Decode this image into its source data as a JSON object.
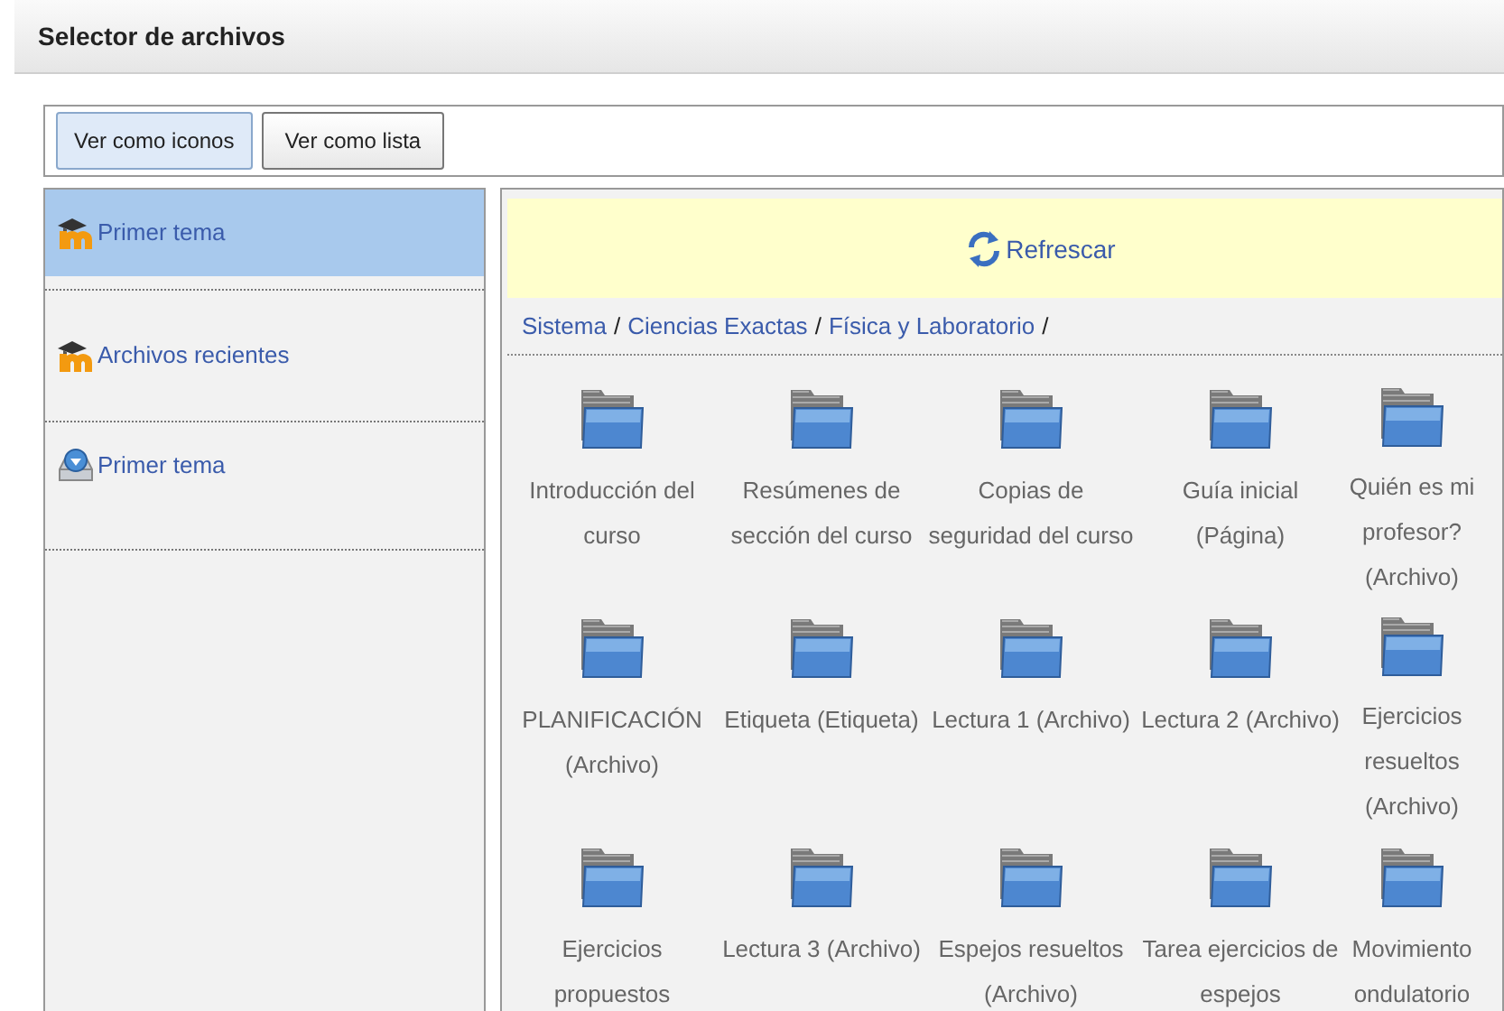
{
  "window": {
    "title": "Selector de archivos"
  },
  "view_buttons": [
    {
      "label": "Ver como iconos",
      "selected": true
    },
    {
      "label": "Ver como lista",
      "selected": false
    }
  ],
  "sidebar": {
    "items": [
      {
        "label": "Primer tema",
        "kind": "moodle",
        "selected": true
      },
      {
        "label": "Archivos recientes",
        "kind": "moodle",
        "selected": false
      },
      {
        "label": "Primer tema",
        "kind": "download",
        "selected": false
      }
    ]
  },
  "refresh": {
    "label": "Refrescar"
  },
  "breadcrumb": {
    "separator": "/",
    "items": [
      "Sistema",
      "Ciencias Exactas",
      "Física y Laboratorio"
    ]
  },
  "files": [
    {
      "label": "Introducción del curso"
    },
    {
      "label": "Resúmenes de sección del curso"
    },
    {
      "label": "Copias de seguridad del curso"
    },
    {
      "label": "Guía inicial (Página)"
    },
    {
      "label": "Quién es mi profesor? (Archivo)"
    },
    {
      "label": "PLANIFICACIÓN (Archivo)"
    },
    {
      "label": "Etiqueta (Etiqueta)"
    },
    {
      "label": "Lectura 1 (Archivo)"
    },
    {
      "label": "Lectura 2 (Archivo)"
    },
    {
      "label": "Ejercicios resueltos (Archivo)"
    },
    {
      "label": "Ejercicios propuestos"
    },
    {
      "label": "Lectura 3 (Archivo)"
    },
    {
      "label": "Espejos resueltos (Archivo)"
    },
    {
      "label": "Tarea ejercicios de espejos"
    },
    {
      "label": "Movimiento ondulatorio"
    }
  ]
}
